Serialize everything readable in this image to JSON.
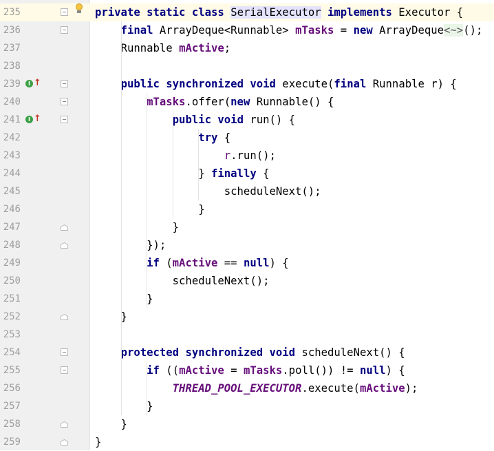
{
  "editor": {
    "lines": [
      {
        "number": "235",
        "segments": [
          {
            "text": "private",
            "style": "kw"
          },
          {
            "text": " "
          },
          {
            "text": "static",
            "style": "kw"
          },
          {
            "text": " "
          },
          {
            "text": "class",
            "style": "kw"
          },
          {
            "text": " "
          },
          {
            "text": "SerialExecutor",
            "style": "hl"
          },
          {
            "text": " "
          },
          {
            "text": "implements",
            "style": "kw"
          },
          {
            "text": " Executor {"
          }
        ]
      },
      {
        "number": "236",
        "segments": [
          {
            "text": "    "
          },
          {
            "text": "final",
            "style": "kw"
          },
          {
            "text": " ArrayDeque<Runnable> "
          },
          {
            "text": "mTasks",
            "style": "fld"
          },
          {
            "text": " = "
          },
          {
            "text": "new",
            "style": "kw"
          },
          {
            "text": " ArrayDeque"
          },
          {
            "text": "<~>",
            "style": "fold"
          },
          {
            "text": "();"
          }
        ]
      },
      {
        "number": "237",
        "segments": [
          {
            "text": "    Runnable "
          },
          {
            "text": "mActive",
            "style": "fld"
          },
          {
            "text": ";"
          }
        ]
      },
      {
        "number": "238",
        "segments": []
      },
      {
        "number": "239",
        "segments": [
          {
            "text": "    "
          },
          {
            "text": "public",
            "style": "kw"
          },
          {
            "text": " "
          },
          {
            "text": "synchronized",
            "style": "kw"
          },
          {
            "text": " "
          },
          {
            "text": "void",
            "style": "kw"
          },
          {
            "text": " execute("
          },
          {
            "text": "final",
            "style": "kw"
          },
          {
            "text": " Runnable r) {"
          }
        ]
      },
      {
        "number": "240",
        "segments": [
          {
            "text": "        "
          },
          {
            "text": "mTasks",
            "style": "fld"
          },
          {
            "text": ".offer("
          },
          {
            "text": "new",
            "style": "kw"
          },
          {
            "text": " Runnable() {"
          }
        ]
      },
      {
        "number": "241",
        "segments": [
          {
            "text": "            "
          },
          {
            "text": "public",
            "style": "kw"
          },
          {
            "text": " "
          },
          {
            "text": "void",
            "style": "kw"
          },
          {
            "text": " run() {"
          }
        ]
      },
      {
        "number": "242",
        "segments": [
          {
            "text": "                "
          },
          {
            "text": "try",
            "style": "kw"
          },
          {
            "text": " {"
          }
        ]
      },
      {
        "number": "243",
        "segments": [
          {
            "text": "                    "
          },
          {
            "text": "r",
            "style": "prm"
          },
          {
            "text": ".run();"
          }
        ]
      },
      {
        "number": "244",
        "segments": [
          {
            "text": "                } "
          },
          {
            "text": "finally",
            "style": "kw"
          },
          {
            "text": " {"
          }
        ]
      },
      {
        "number": "245",
        "segments": [
          {
            "text": "                    scheduleNext();"
          }
        ]
      },
      {
        "number": "246",
        "segments": [
          {
            "text": "                }"
          }
        ]
      },
      {
        "number": "247",
        "segments": [
          {
            "text": "            }"
          }
        ]
      },
      {
        "number": "248",
        "segments": [
          {
            "text": "        });"
          }
        ]
      },
      {
        "number": "249",
        "segments": [
          {
            "text": "        "
          },
          {
            "text": "if",
            "style": "kw"
          },
          {
            "text": " ("
          },
          {
            "text": "mActive",
            "style": "fld"
          },
          {
            "text": " == "
          },
          {
            "text": "null",
            "style": "kw"
          },
          {
            "text": ") {"
          }
        ]
      },
      {
        "number": "250",
        "segments": [
          {
            "text": "            scheduleNext();"
          }
        ]
      },
      {
        "number": "251",
        "segments": [
          {
            "text": "        }"
          }
        ]
      },
      {
        "number": "252",
        "segments": [
          {
            "text": "    }"
          }
        ]
      },
      {
        "number": "253",
        "segments": []
      },
      {
        "number": "254",
        "segments": [
          {
            "text": "    "
          },
          {
            "text": "protected",
            "style": "kw"
          },
          {
            "text": " "
          },
          {
            "text": "synchronized",
            "style": "kw"
          },
          {
            "text": " "
          },
          {
            "text": "void",
            "style": "kw"
          },
          {
            "text": " scheduleNext() {"
          }
        ]
      },
      {
        "number": "255",
        "segments": [
          {
            "text": "        "
          },
          {
            "text": "if",
            "style": "kw"
          },
          {
            "text": " (("
          },
          {
            "text": "mActive",
            "style": "fld"
          },
          {
            "text": " = "
          },
          {
            "text": "mTasks",
            "style": "fld"
          },
          {
            "text": ".poll()) != "
          },
          {
            "text": "null",
            "style": "kw"
          },
          {
            "text": ") {"
          }
        ]
      },
      {
        "number": "256",
        "segments": [
          {
            "text": "            "
          },
          {
            "text": "THREAD_POOL_EXECUTOR",
            "style": "cst"
          },
          {
            "text": ".execute("
          },
          {
            "text": "mActive",
            "style": "fld"
          },
          {
            "text": ");"
          }
        ]
      },
      {
        "number": "257",
        "segments": [
          {
            "text": "        }"
          }
        ]
      },
      {
        "number": "258",
        "segments": [
          {
            "text": "    }"
          }
        ]
      },
      {
        "number": "259",
        "segments": [
          {
            "text": "}"
          }
        ]
      }
    ],
    "gutter_icons": [
      {
        "line": "235",
        "icon": "intention-bulb-icon"
      },
      {
        "line": "239",
        "icon": "override-method-icon"
      },
      {
        "line": "241",
        "icon": "override-method-icon"
      }
    ],
    "colors": {
      "keyword": "#000080",
      "field": "#660e7a",
      "line_number": "#9e9e9e",
      "gutter_bg": "#f0f0f0",
      "current_line": "#fffbe6"
    }
  }
}
